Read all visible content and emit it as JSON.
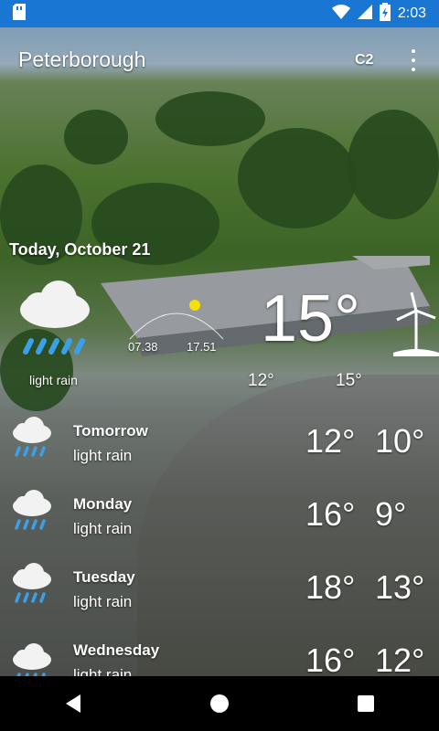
{
  "status_bar": {
    "time": "2:03",
    "icons": [
      "sd-card-icon",
      "wifi-icon",
      "cell-signal-icon",
      "battery-charging-icon"
    ],
    "color": "#1976d2"
  },
  "header": {
    "city": "Peterborough",
    "unit_badge": "C2",
    "menu_icon": "more-vert-icon"
  },
  "today": {
    "date_label": "Today, October 21",
    "condition": "light rain",
    "current_temp": "15°",
    "sunrise": "07.38",
    "sunset": "17.51",
    "low": "12°",
    "high": "15°",
    "wind_icon": "wind-turbine-icon"
  },
  "forecast": [
    {
      "day": "Tomorrow",
      "condition": "light rain",
      "high": "12°",
      "low": "10°",
      "icon": "cloud-rain-icon"
    },
    {
      "day": "Monday",
      "condition": "light rain",
      "high": "16°",
      "low": "9°",
      "icon": "cloud-rain-icon"
    },
    {
      "day": "Tuesday",
      "condition": "light rain",
      "high": "18°",
      "low": "13°",
      "icon": "cloud-rain-icon"
    },
    {
      "day": "Wednesday",
      "condition": "light rain",
      "high": "16°",
      "low": "12°",
      "icon": "cloud-rain-icon"
    }
  ],
  "nav": {
    "back": "back-icon",
    "home": "home-icon",
    "recents": "recents-icon"
  },
  "colors": {
    "rain_blue": "#3aa0e8",
    "sun_yellow": "#f5e100"
  }
}
